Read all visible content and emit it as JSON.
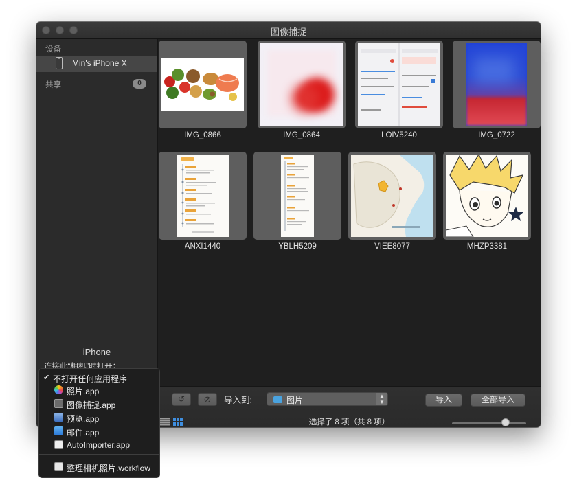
{
  "window": {
    "title": "图像捕捉"
  },
  "sidebar": {
    "devices_header": "设备",
    "device_name": "Min's iPhone X",
    "shared_header": "共享",
    "shared_count": "0",
    "device_section_title": "iPhone",
    "open_with_label": "连接此“相机”时打开："
  },
  "photos": [
    {
      "name": "IMG_0866",
      "kind": "food-photo"
    },
    {
      "name": "IMG_0864",
      "kind": "blurred-red"
    },
    {
      "name": "LOIV5240",
      "kind": "screenshot-settings"
    },
    {
      "name": "IMG_0722",
      "kind": "blurred-blue"
    },
    {
      "name": "ANXI1440",
      "kind": "timeline-document"
    },
    {
      "name": "YBLH5209",
      "kind": "timeline-document"
    },
    {
      "name": "VIEE8077",
      "kind": "map"
    },
    {
      "name": "MHZP3381",
      "kind": "anime-drawing"
    }
  ],
  "toolbar": {
    "import_to_label": "导入到:",
    "destination": "图片",
    "import_label": "导入",
    "import_all_label": "全部导入",
    "status": "选择了 8 项（共 8 项）",
    "thumb_size_level": 0.72,
    "view_mode": "grid"
  },
  "app_menu": {
    "items": [
      {
        "label": "不打开任何应用程序",
        "checked": true,
        "icon": ""
      },
      {
        "label": "照片.app",
        "checked": false,
        "icon": "photos-icon"
      },
      {
        "label": "图像捕捉.app",
        "checked": false,
        "icon": "image-capture-icon"
      },
      {
        "label": "预览.app",
        "checked": false,
        "icon": "preview-icon"
      },
      {
        "label": "邮件.app",
        "checked": false,
        "icon": "mail-icon"
      },
      {
        "label": "AutoImporter.app",
        "checked": false,
        "icon": "autoimporter-icon"
      },
      {
        "label": "整理相机照片.workflow",
        "checked": false,
        "icon": "workflow-icon"
      }
    ]
  },
  "colors": {
    "accent": "#4aa3df",
    "selection": "#5e5e5e",
    "background": "#1f1f1f"
  }
}
